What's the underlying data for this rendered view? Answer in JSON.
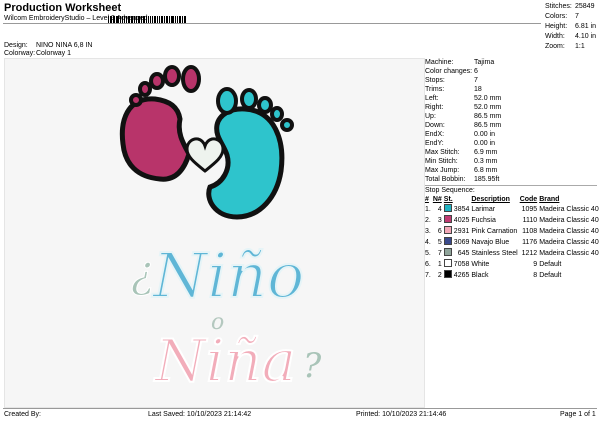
{
  "header": {
    "title": "Production Worksheet",
    "subtitle": "Wilcom EmbroideryStudio – Level 3 Advanced",
    "design_label": "Design:",
    "design_value": "NINO NINA 6,8 IN",
    "colorway_label": "Colorway:",
    "colorway_value": "Colorway 1"
  },
  "top_stats": [
    {
      "label": "Stitches:",
      "value": "25849"
    },
    {
      "label": "Colors:",
      "value": "7"
    },
    {
      "label": "Height:",
      "value": "6.81 in"
    },
    {
      "label": "Width:",
      "value": "4.10 in"
    },
    {
      "label": "Zoom:",
      "value": "1:1"
    }
  ],
  "machine_info": [
    {
      "label": "Machine:",
      "value": "Tajima"
    },
    {
      "label": "Color changes:",
      "value": "6"
    },
    {
      "label": "Stops:",
      "value": "7"
    },
    {
      "label": "Trims:",
      "value": "18"
    },
    {
      "label": "Left:",
      "value": "52.0 mm"
    },
    {
      "label": "Right:",
      "value": "52.0 mm"
    },
    {
      "label": "Up:",
      "value": "86.5 mm"
    },
    {
      "label": "Down:",
      "value": "86.5 mm"
    },
    {
      "label": "EndX:",
      "value": "0.00 in"
    },
    {
      "label": "EndY:",
      "value": "0.00 in"
    },
    {
      "label": "Max Stitch:",
      "value": "6.9 mm"
    },
    {
      "label": "Min Stitch:",
      "value": "0.3 mm"
    },
    {
      "label": "Max Jump:",
      "value": "6.8 mm"
    },
    {
      "label": "Total Bobbin:",
      "value": "185.95ft"
    }
  ],
  "stop_sequence": {
    "title": "Stop Sequence:",
    "columns": [
      "#",
      "N#",
      "St.",
      "Description",
      "Code",
      "Brand"
    ],
    "rows": [
      {
        "num": "1.",
        "needle": "4",
        "color": "#1fb3c2",
        "st": "3854",
        "desc": "Larimar",
        "code": "1095",
        "brand": "Madeira Classic 40"
      },
      {
        "num": "2.",
        "needle": "3",
        "color": "#c03a72",
        "st": "4025",
        "desc": "Fuchsia",
        "code": "1110",
        "brand": "Madeira Classic 40"
      },
      {
        "num": "3.",
        "needle": "6",
        "color": "#f2a7b6",
        "st": "2931",
        "desc": "Pink Carnation",
        "code": "1108",
        "brand": "Madeira Classic 40"
      },
      {
        "num": "4.",
        "needle": "5",
        "color": "#3a4a8c",
        "st": "3069",
        "desc": "Navajo Blue",
        "code": "1176",
        "brand": "Madeira Classic 40"
      },
      {
        "num": "5.",
        "needle": "7",
        "color": "#8fa49a",
        "st": "645",
        "desc": "Stainless Steel",
        "code": "1212",
        "brand": "Madeira Classic 40"
      },
      {
        "num": "6.",
        "needle": "1",
        "color": "#ffffff",
        "st": "7058",
        "desc": "White",
        "code": "9",
        "brand": "Default"
      },
      {
        "num": "7.",
        "needle": "2",
        "color": "#000000",
        "st": "4265",
        "desc": "Black",
        "code": "8",
        "brand": "Default"
      }
    ]
  },
  "design_text": {
    "question_open": "¿",
    "nino": "Niño",
    "o": "o",
    "nina": "Niña",
    "question_close": "?"
  },
  "footer": {
    "created_by": "Created By:",
    "last_saved": "Last Saved: 10/10/2023 21:14:42",
    "printed": "Printed: 10/10/2023 21:14:46",
    "page": "Page 1 of 1"
  }
}
